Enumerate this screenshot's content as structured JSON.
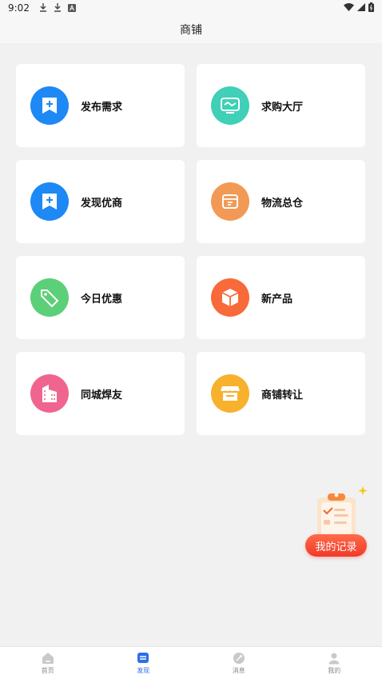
{
  "status_bar": {
    "time": "9:02"
  },
  "header": {
    "title": "商铺"
  },
  "cards": [
    {
      "label": "发布需求",
      "icon": "bookmark-plus-icon",
      "color": "#1e88f5"
    },
    {
      "label": "求购大厅",
      "icon": "monitor-icon",
      "color": "#3fd0b7"
    },
    {
      "label": "发现优商",
      "icon": "bookmark-plus-icon",
      "color": "#1e88f5"
    },
    {
      "label": "物流总仓",
      "icon": "box-icon",
      "color": "#f29a55"
    },
    {
      "label": "今日优惠",
      "icon": "tag-icon",
      "color": "#5ccf79"
    },
    {
      "label": "新产品",
      "icon": "cube-icon",
      "color": "#f86a3a"
    },
    {
      "label": "同城焊友",
      "icon": "building-icon",
      "color": "#f0658f"
    },
    {
      "label": "商铺转让",
      "icon": "shop-icon",
      "color": "#f7b12c"
    }
  ],
  "floating": {
    "label": "我的记录",
    "icon": "clipboard-check-icon"
  },
  "tabbar": {
    "items": [
      {
        "label": "首页",
        "icon": "home-icon",
        "active": false
      },
      {
        "label": "发现",
        "icon": "discover-icon",
        "active": true
      },
      {
        "label": "消息",
        "icon": "message-icon",
        "active": false
      },
      {
        "label": "我的",
        "icon": "user-icon",
        "active": false
      }
    ],
    "active_color": "#2f6de8"
  }
}
